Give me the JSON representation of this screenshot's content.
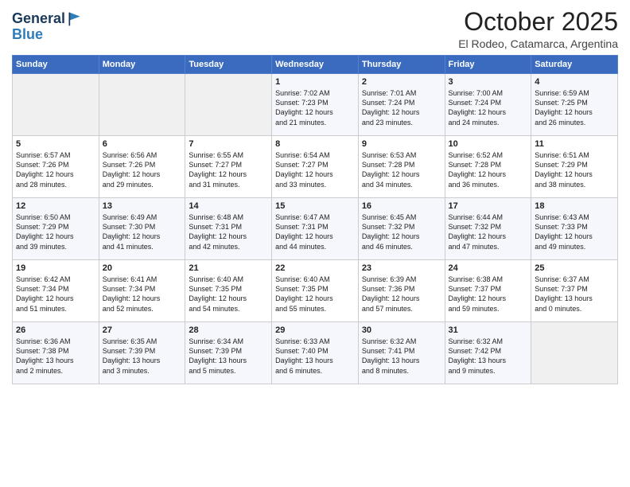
{
  "header": {
    "logo_line1": "General",
    "logo_line2": "Blue",
    "title": "October 2025",
    "subtitle": "El Rodeo, Catamarca, Argentina"
  },
  "weekdays": [
    "Sunday",
    "Monday",
    "Tuesday",
    "Wednesday",
    "Thursday",
    "Friday",
    "Saturday"
  ],
  "weeks": [
    [
      {
        "day": "",
        "info": ""
      },
      {
        "day": "",
        "info": ""
      },
      {
        "day": "",
        "info": ""
      },
      {
        "day": "1",
        "info": "Sunrise: 7:02 AM\nSunset: 7:23 PM\nDaylight: 12 hours\nand 21 minutes."
      },
      {
        "day": "2",
        "info": "Sunrise: 7:01 AM\nSunset: 7:24 PM\nDaylight: 12 hours\nand 23 minutes."
      },
      {
        "day": "3",
        "info": "Sunrise: 7:00 AM\nSunset: 7:24 PM\nDaylight: 12 hours\nand 24 minutes."
      },
      {
        "day": "4",
        "info": "Sunrise: 6:59 AM\nSunset: 7:25 PM\nDaylight: 12 hours\nand 26 minutes."
      }
    ],
    [
      {
        "day": "5",
        "info": "Sunrise: 6:57 AM\nSunset: 7:26 PM\nDaylight: 12 hours\nand 28 minutes."
      },
      {
        "day": "6",
        "info": "Sunrise: 6:56 AM\nSunset: 7:26 PM\nDaylight: 12 hours\nand 29 minutes."
      },
      {
        "day": "7",
        "info": "Sunrise: 6:55 AM\nSunset: 7:27 PM\nDaylight: 12 hours\nand 31 minutes."
      },
      {
        "day": "8",
        "info": "Sunrise: 6:54 AM\nSunset: 7:27 PM\nDaylight: 12 hours\nand 33 minutes."
      },
      {
        "day": "9",
        "info": "Sunrise: 6:53 AM\nSunset: 7:28 PM\nDaylight: 12 hours\nand 34 minutes."
      },
      {
        "day": "10",
        "info": "Sunrise: 6:52 AM\nSunset: 7:28 PM\nDaylight: 12 hours\nand 36 minutes."
      },
      {
        "day": "11",
        "info": "Sunrise: 6:51 AM\nSunset: 7:29 PM\nDaylight: 12 hours\nand 38 minutes."
      }
    ],
    [
      {
        "day": "12",
        "info": "Sunrise: 6:50 AM\nSunset: 7:29 PM\nDaylight: 12 hours\nand 39 minutes."
      },
      {
        "day": "13",
        "info": "Sunrise: 6:49 AM\nSunset: 7:30 PM\nDaylight: 12 hours\nand 41 minutes."
      },
      {
        "day": "14",
        "info": "Sunrise: 6:48 AM\nSunset: 7:31 PM\nDaylight: 12 hours\nand 42 minutes."
      },
      {
        "day": "15",
        "info": "Sunrise: 6:47 AM\nSunset: 7:31 PM\nDaylight: 12 hours\nand 44 minutes."
      },
      {
        "day": "16",
        "info": "Sunrise: 6:45 AM\nSunset: 7:32 PM\nDaylight: 12 hours\nand 46 minutes."
      },
      {
        "day": "17",
        "info": "Sunrise: 6:44 AM\nSunset: 7:32 PM\nDaylight: 12 hours\nand 47 minutes."
      },
      {
        "day": "18",
        "info": "Sunrise: 6:43 AM\nSunset: 7:33 PM\nDaylight: 12 hours\nand 49 minutes."
      }
    ],
    [
      {
        "day": "19",
        "info": "Sunrise: 6:42 AM\nSunset: 7:34 PM\nDaylight: 12 hours\nand 51 minutes."
      },
      {
        "day": "20",
        "info": "Sunrise: 6:41 AM\nSunset: 7:34 PM\nDaylight: 12 hours\nand 52 minutes."
      },
      {
        "day": "21",
        "info": "Sunrise: 6:40 AM\nSunset: 7:35 PM\nDaylight: 12 hours\nand 54 minutes."
      },
      {
        "day": "22",
        "info": "Sunrise: 6:40 AM\nSunset: 7:35 PM\nDaylight: 12 hours\nand 55 minutes."
      },
      {
        "day": "23",
        "info": "Sunrise: 6:39 AM\nSunset: 7:36 PM\nDaylight: 12 hours\nand 57 minutes."
      },
      {
        "day": "24",
        "info": "Sunrise: 6:38 AM\nSunset: 7:37 PM\nDaylight: 12 hours\nand 59 minutes."
      },
      {
        "day": "25",
        "info": "Sunrise: 6:37 AM\nSunset: 7:37 PM\nDaylight: 13 hours\nand 0 minutes."
      }
    ],
    [
      {
        "day": "26",
        "info": "Sunrise: 6:36 AM\nSunset: 7:38 PM\nDaylight: 13 hours\nand 2 minutes."
      },
      {
        "day": "27",
        "info": "Sunrise: 6:35 AM\nSunset: 7:39 PM\nDaylight: 13 hours\nand 3 minutes."
      },
      {
        "day": "28",
        "info": "Sunrise: 6:34 AM\nSunset: 7:39 PM\nDaylight: 13 hours\nand 5 minutes."
      },
      {
        "day": "29",
        "info": "Sunrise: 6:33 AM\nSunset: 7:40 PM\nDaylight: 13 hours\nand 6 minutes."
      },
      {
        "day": "30",
        "info": "Sunrise: 6:32 AM\nSunset: 7:41 PM\nDaylight: 13 hours\nand 8 minutes."
      },
      {
        "day": "31",
        "info": "Sunrise: 6:32 AM\nSunset: 7:42 PM\nDaylight: 13 hours\nand 9 minutes."
      },
      {
        "day": "",
        "info": ""
      }
    ]
  ]
}
